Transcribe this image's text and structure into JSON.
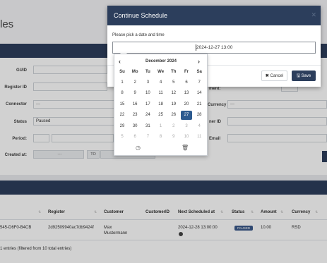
{
  "page": {
    "title_fragment": "les"
  },
  "form": {
    "guid_label": "GUID",
    "register_id_label": "Register ID",
    "connector_label": "Connector",
    "connector_value": "---",
    "status_label": "Status",
    "status_value": "Paused",
    "period_label": "Period:",
    "created_label": "Created at:",
    "created_to": "TO",
    "created_dash": "---",
    "right_labels": [
      "ment:",
      "Currency",
      "ner ID",
      "Email"
    ],
    "currency_value": "---"
  },
  "table": {
    "headers": [
      "Register",
      "Customer",
      "CustomerID",
      "Next Scheduled at",
      "Status",
      "Amount",
      "Currency"
    ],
    "row": {
      "id_fragment": "545-D6F0-B4CB",
      "register": "2d92509940ac7db9424f",
      "customer_line1": "Max",
      "customer_line2": "Mustermann",
      "next_scheduled": "2024-12-28 13:00:00",
      "status": "PAUSED",
      "amount": "10.00",
      "currency": "RSD"
    },
    "footer": "1 entries (filtered from 10 total entries)"
  },
  "modal": {
    "title": "Continue Schedule",
    "prompt": "Please pick a date and time",
    "datetime_value": "2024-12-27 13:00",
    "cancel_label": "Cancel",
    "save_label": "Save"
  },
  "calendar": {
    "month_label": "December 2024",
    "weekdays": [
      "Su",
      "Mo",
      "Tu",
      "We",
      "Th",
      "Fr",
      "Sa"
    ],
    "weeks": [
      [
        "1",
        "2",
        "3",
        "4",
        "5",
        "6",
        "7"
      ],
      [
        "8",
        "9",
        "10",
        "11",
        "12",
        "13",
        "14"
      ],
      [
        "15",
        "16",
        "17",
        "18",
        "19",
        "20",
        "21"
      ],
      [
        "22",
        "23",
        "24",
        "25",
        "26",
        "27",
        "28"
      ],
      [
        "29",
        "30",
        "31",
        "1",
        "2",
        "3",
        "4"
      ],
      [
        "5",
        "6",
        "7",
        "8",
        "9",
        "10",
        "11"
      ]
    ],
    "selected_day": "27",
    "icons": [
      "clock-icon",
      "trash-icon"
    ]
  },
  "colors": {
    "navy": "#2c3e5c",
    "selected": "#2c5a8f"
  }
}
